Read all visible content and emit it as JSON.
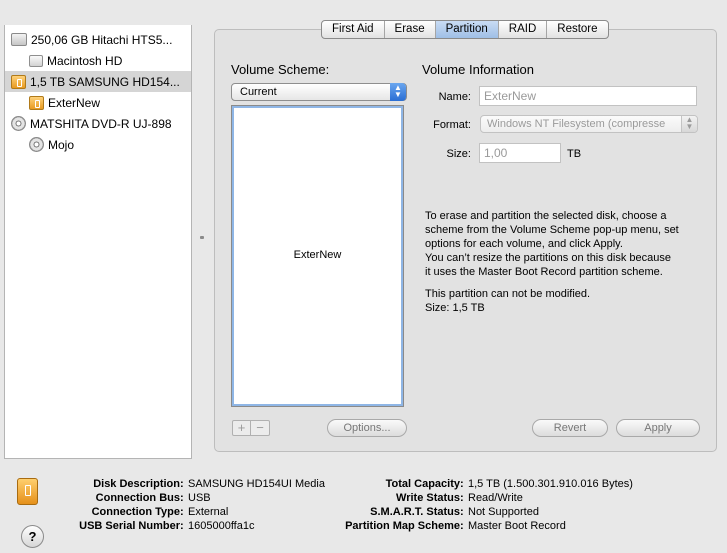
{
  "sidebar": {
    "items": [
      {
        "label": "250,06 GB Hitachi HTS5...",
        "icon": "internal-disk-icon"
      },
      {
        "label": "Macintosh HD",
        "icon": "volume-icon"
      },
      {
        "label": "1,5 TB SAMSUNG HD154...",
        "icon": "external-disk-icon",
        "selected": true
      },
      {
        "label": "ExterNew",
        "icon": "external-volume-icon"
      },
      {
        "label": "MATSHITA DVD-R UJ-898",
        "icon": "optical-drive-icon"
      },
      {
        "label": "Mojo",
        "icon": "disc-icon"
      }
    ]
  },
  "tabs": [
    {
      "label": "First Aid"
    },
    {
      "label": "Erase"
    },
    {
      "label": "Partition",
      "active": true
    },
    {
      "label": "RAID"
    },
    {
      "label": "Restore"
    }
  ],
  "partition": {
    "volume_scheme_title": "Volume Scheme:",
    "scheme_selected": "Current",
    "partition_label": "ExterNew",
    "add_label": "+",
    "remove_label": "−",
    "options_label": "Options...",
    "volume_info_title": "Volume Information",
    "name_label": "Name:",
    "name_value": "ExterNew",
    "format_label": "Format:",
    "format_value": "Windows NT Filesystem (compresse",
    "size_label": "Size:",
    "size_value": "1,00",
    "size_unit": "TB",
    "info_lines": [
      "To erase and partition the selected disk, choose a",
      "scheme from the Volume Scheme pop-up menu, set",
      "options for each volume, and click Apply.",
      "You can’t resize the partitions on this disk because",
      "it uses the Master Boot Record partition scheme."
    ],
    "info_lines2": [
      "This partition can not be modified.",
      "Size: 1,5 TB"
    ],
    "revert_label": "Revert",
    "apply_label": "Apply"
  },
  "info_bar": {
    "left": [
      {
        "key": "Disk Description",
        "value": "SAMSUNG HD154UI Media"
      },
      {
        "key": "Connection Bus",
        "value": "USB"
      },
      {
        "key": "Connection Type",
        "value": "External"
      },
      {
        "key": "USB Serial Number",
        "value": "1605000ffa1c"
      }
    ],
    "right": [
      {
        "key": "Total Capacity",
        "value": "1,5 TB (1.500.301.910.016 Bytes)"
      },
      {
        "key": "Write Status",
        "value": "Read/Write"
      },
      {
        "key": "S.M.A.R.T. Status",
        "value": "Not Supported"
      },
      {
        "key": "Partition Map Scheme",
        "value": "Master Boot Record"
      }
    ],
    "help_label": "?"
  }
}
